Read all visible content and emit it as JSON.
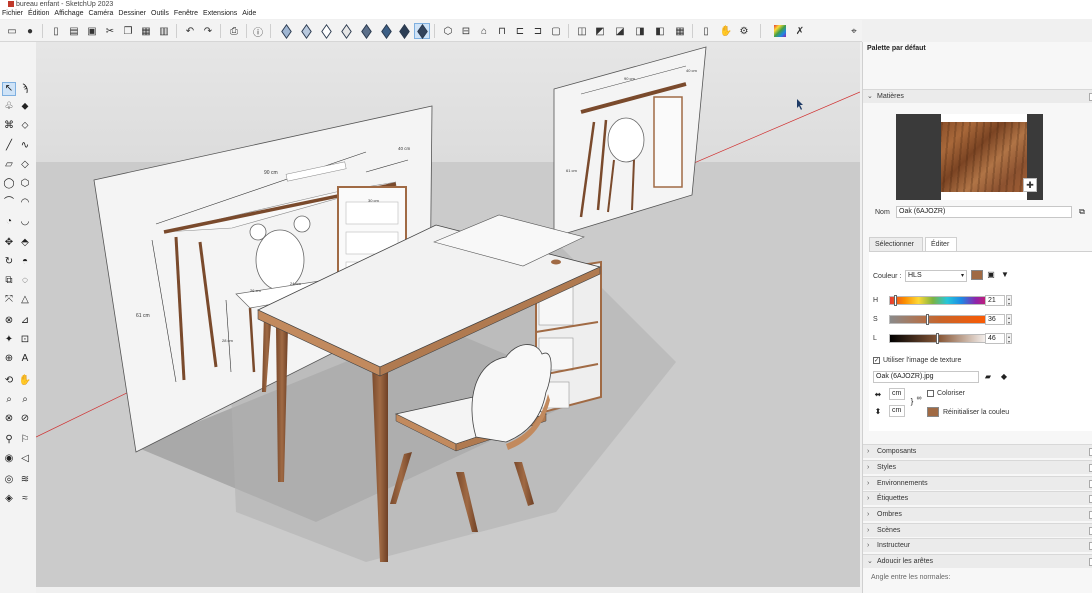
{
  "window": {
    "title": "bureau enfant - SketchUp 2023"
  },
  "menu": [
    "Fichier",
    "Édition",
    "Affichage",
    "Caméra",
    "Dessiner",
    "Outils",
    "Fenêtre",
    "Extensions",
    "Aide"
  ],
  "tray": {
    "title": "Palette par défaut",
    "materials": {
      "header": "Matières",
      "name_label": "Nom",
      "name_value": "Oak (6AJOZR)",
      "tab_select": "Sélectionner",
      "tab_edit": "Éditer",
      "color_label": "Couleur :",
      "color_mode": "HLS",
      "h_label": "H",
      "h_value": "21",
      "s_label": "S",
      "s_value": "36",
      "l_label": "L",
      "l_value": "46",
      "texture_check": "Utiliser l'image de texture",
      "texture_file": "Oak (6AJOZR).jpg",
      "width_value": "cm",
      "height_value": "cm",
      "colorize": "Coloriser",
      "reset_color": "Réinitialiser la couleu",
      "swatch_color": "#a06a44"
    },
    "sections": [
      {
        "label": "Composants"
      },
      {
        "label": "Styles"
      },
      {
        "label": "Environnements"
      },
      {
        "label": "Étiquettes"
      },
      {
        "label": "Ombres"
      },
      {
        "label": "Scènes"
      },
      {
        "label": "Instructeur"
      },
      {
        "label": "Adoucir les arêtes"
      }
    ],
    "soften_label": "Angle entre les normales:"
  },
  "viewport": {
    "panel_front": {
      "dim_top": "90 cm",
      "dim_depth": "40 cm",
      "dim_height": "61 cm",
      "dim_drawer": "30 cm",
      "dim_seat": "24 cm",
      "dim_seat_h": "28 cm",
      "dim_seat_w": "26 cm"
    },
    "panel_back": {
      "dim_top": "90 cm",
      "dim_side": "40 cm",
      "dim_height": "61 cm"
    }
  }
}
